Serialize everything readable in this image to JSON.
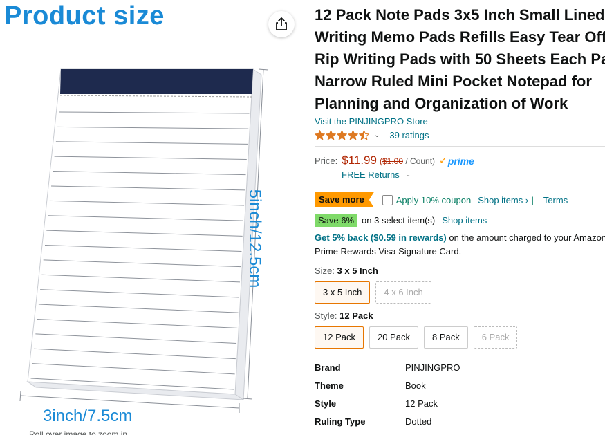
{
  "image_panel": {
    "title": "Product size",
    "width_label": "3inch/7.5cm",
    "height_label": "5inch/12.5cm",
    "rollover_text": "Roll over image to zoom in",
    "ruled_line_count": 19,
    "cover_color": "#1e2a4e",
    "accent_color": "#1a8ad6"
  },
  "share": {
    "icon": "share-icon"
  },
  "product": {
    "title_lines": [
      "12 Pack Note Pads 3x5 Inch Small Lined",
      "Writing Memo Pads Refills Easy Tear Off",
      "Rip Writing Pads with 50 Sheets Each Pad",
      "Narrow Ruled Mini Pocket Notepad for",
      "Planning and Organization of Work"
    ],
    "store_link": "Visit the PINJINGPRO Store",
    "rating_stars": 4.5,
    "ratings_count": "39 ratings"
  },
  "price": {
    "label": "Price:",
    "amount": "$11.99",
    "unit_open": "(",
    "unit_strike": "$1.00",
    "unit_rest": " / Count)",
    "prime_label": "prime",
    "returns": "FREE Returns"
  },
  "coupon": {
    "badge": "Save more",
    "text": "Apply 10% coupon",
    "shop_items": "Shop items ›",
    "separator": "|",
    "terms": "Terms"
  },
  "promo": {
    "badge": "Save 6%",
    "text": "on 3 select item(s)",
    "link": "Shop items"
  },
  "rewards": {
    "link": "Get 5% back ($0.59 in rewards)",
    "text1": " on the amount charged to your Amazon",
    "text2": "Prime Rewards Visa Signature Card."
  },
  "size_variation": {
    "label": "Size:",
    "selected": "3 x 5 Inch",
    "options": [
      "3 x 5 Inch",
      "4 x 6 Inch"
    ]
  },
  "style_variation": {
    "label": "Style:",
    "selected": "12 Pack",
    "options": [
      "12 Pack",
      "20 Pack",
      "8 Pack",
      "6 Pack"
    ]
  },
  "specs": [
    {
      "key": "Brand",
      "value": "PINJINGPRO"
    },
    {
      "key": "Theme",
      "value": "Book"
    },
    {
      "key": "Style",
      "value": "12 Pack"
    },
    {
      "key": "Ruling Type",
      "value": "Dotted"
    }
  ]
}
